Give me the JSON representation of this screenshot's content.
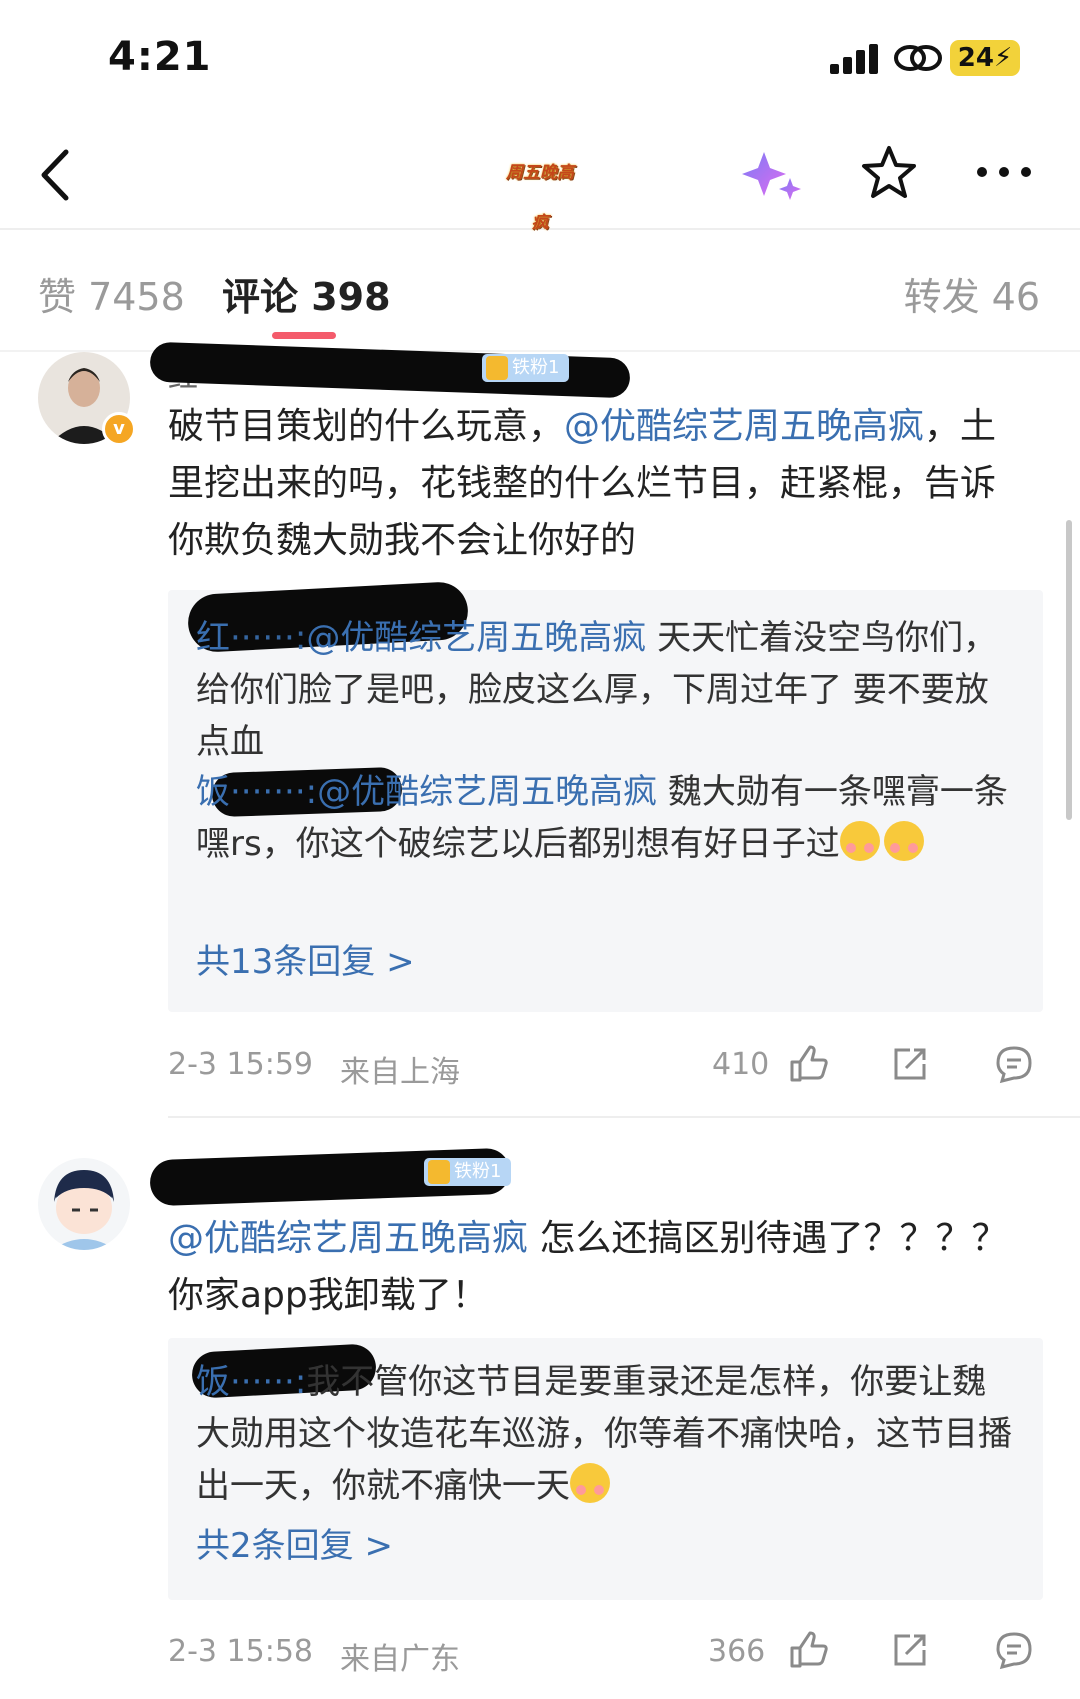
{
  "status_bar": {
    "time": "4:21",
    "battery": "24"
  },
  "nav": {
    "channel_logo_text": "周五晚高疯"
  },
  "tabs": {
    "likes": "赞 7458",
    "comments": "评论 398",
    "reposts": "转发 46",
    "active": "comments"
  },
  "comments": [
    {
      "username_visible": "红",
      "fan_badge": "铁粉1",
      "text_before": "破节目策划的什么玩意，",
      "mention": "@优酷综艺周五晚高疯",
      "text_after": "，土里挖出来的吗，花钱整的什么烂节目，赶紧棍，告诉你欺负魏大勋我不会让你好的",
      "replies": [
        {
          "user_visible": "红",
          "mention": "@优酷综艺周五晚高疯",
          "text": " 天天忙着没空鸟你们，给你们脸了是吧，脸皮这么厚，下周过年了 要不要放点血"
        },
        {
          "user_visible": "饭",
          "mention": "@优酷综艺周五晚高疯",
          "text": " 魏大勋有一条嘿膏一条嘿rs，你这个破综艺以后都别想有好日子过"
        }
      ],
      "more_replies": "共13条回复 >",
      "time": "2-3 15:59",
      "location": "来自上海",
      "likes": "410"
    },
    {
      "username_visible": "",
      "fan_badge": "铁粉1",
      "text_before": "",
      "mention": "@优酷综艺周五晚高疯",
      "text_after": " 怎么还搞区别待遇了？？？？ 你家app我卸载了！",
      "replies": [
        {
          "user_visible": "饭",
          "mention": "",
          "text": "我不管你这节目是要重录还是怎样，你要让魏大勋用这个妆造花车巡游，你等着不痛快哈，这节目播出一天，你就不痛快一天"
        }
      ],
      "more_replies": "共2条回复 >",
      "time": "2-3 15:58",
      "location": "来自广东",
      "likes": "366"
    }
  ],
  "colors": {
    "accent_link": "#3a6fb0",
    "tab_underline": "#f45b6b",
    "battery": "#f2d23a",
    "verified_badge": "#f5a623"
  },
  "icons": [
    "back-icon",
    "sparkle-icon",
    "star-icon",
    "more-icon",
    "like-icon",
    "share-icon",
    "comment-icon"
  ]
}
